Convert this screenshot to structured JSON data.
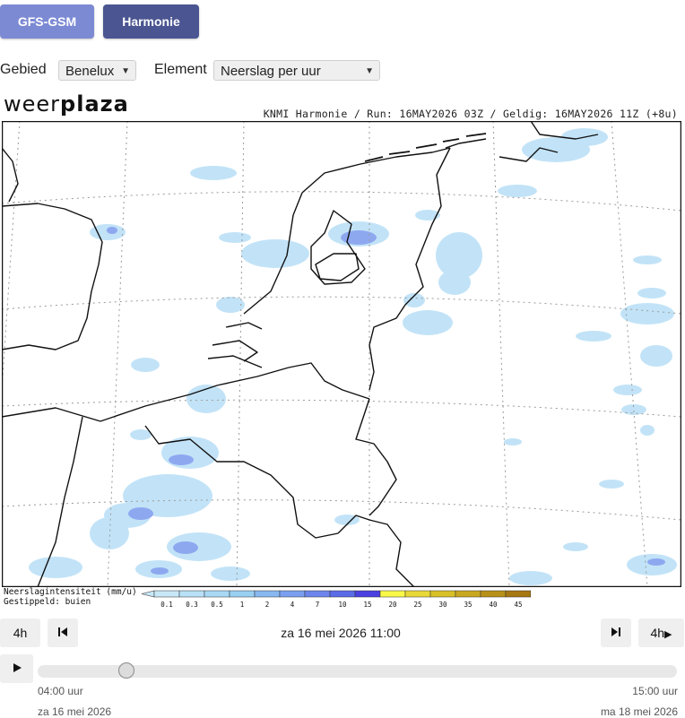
{
  "models": {
    "gfs_label": "GFS-GSM",
    "harmonie_label": "Harmonie",
    "colors": {
      "gfs": "#7c8ad4",
      "harmonie": "#4a5591"
    }
  },
  "selectors": {
    "area_label": "Gebied",
    "area_value": "Benelux",
    "element_label": "Element",
    "element_value": "Neerslag per uur"
  },
  "map": {
    "brand_regular": "weer",
    "brand_bold": "plaza",
    "run_info": "KNMI Harmonie / Run: 16MAY2026 03Z / Geldig: 16MAY2026 11Z (+8u)"
  },
  "legend": {
    "title": "Neerslagintensiteit (mm/u)",
    "subtitle": "Gestippeld: buien",
    "ticks": [
      "0.1",
      "0.3",
      "0.5",
      "1",
      "2",
      "4",
      "7",
      "10",
      "15",
      "20",
      "25",
      "30",
      "35",
      "40",
      "45"
    ],
    "colors": [
      "#c8e8f8",
      "#b8e0f6",
      "#a8d8f4",
      "#98d0f2",
      "#88b8f0",
      "#7a9ff0",
      "#6c86ec",
      "#5a6be8",
      "#4a40e0",
      "#f8f848",
      "#e8d838",
      "#d8c028",
      "#c8a820",
      "#b89018",
      "#a87810"
    ]
  },
  "controls": {
    "step_back_label": "4h",
    "step_fwd_label": "4h",
    "current_time": "za 16 mei 2026 11:00",
    "range_start_time": "04:00 uur",
    "range_end_time": "15:00 uur",
    "range_start_date": "za 16 mei 2026",
    "range_end_date": "ma 18 mei 2026",
    "slider_position": 0.13
  }
}
